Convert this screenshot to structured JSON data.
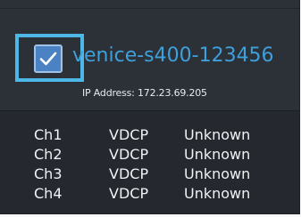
{
  "device": {
    "name": "venice-s400-123456",
    "ip_address": "IP Address: 172.23.69.205",
    "selected": true
  },
  "channels": [
    {
      "channel": "Ch1",
      "protocol": "VDCP",
      "status": "Unknown"
    },
    {
      "channel": "Ch2",
      "protocol": "VDCP",
      "status": "Unknown"
    },
    {
      "channel": "Ch3",
      "protocol": "VDCP",
      "status": "Unknown"
    },
    {
      "channel": "Ch4",
      "protocol": "VDCP",
      "status": "Unknown"
    }
  ],
  "colors": {
    "accent": "#3ea0dc",
    "focus_outline": "#4db7e8",
    "checkbox_fill": "#4a82c4",
    "card_background": "#25292f"
  },
  "icons": {
    "checkbox": "checkmark-icon"
  }
}
